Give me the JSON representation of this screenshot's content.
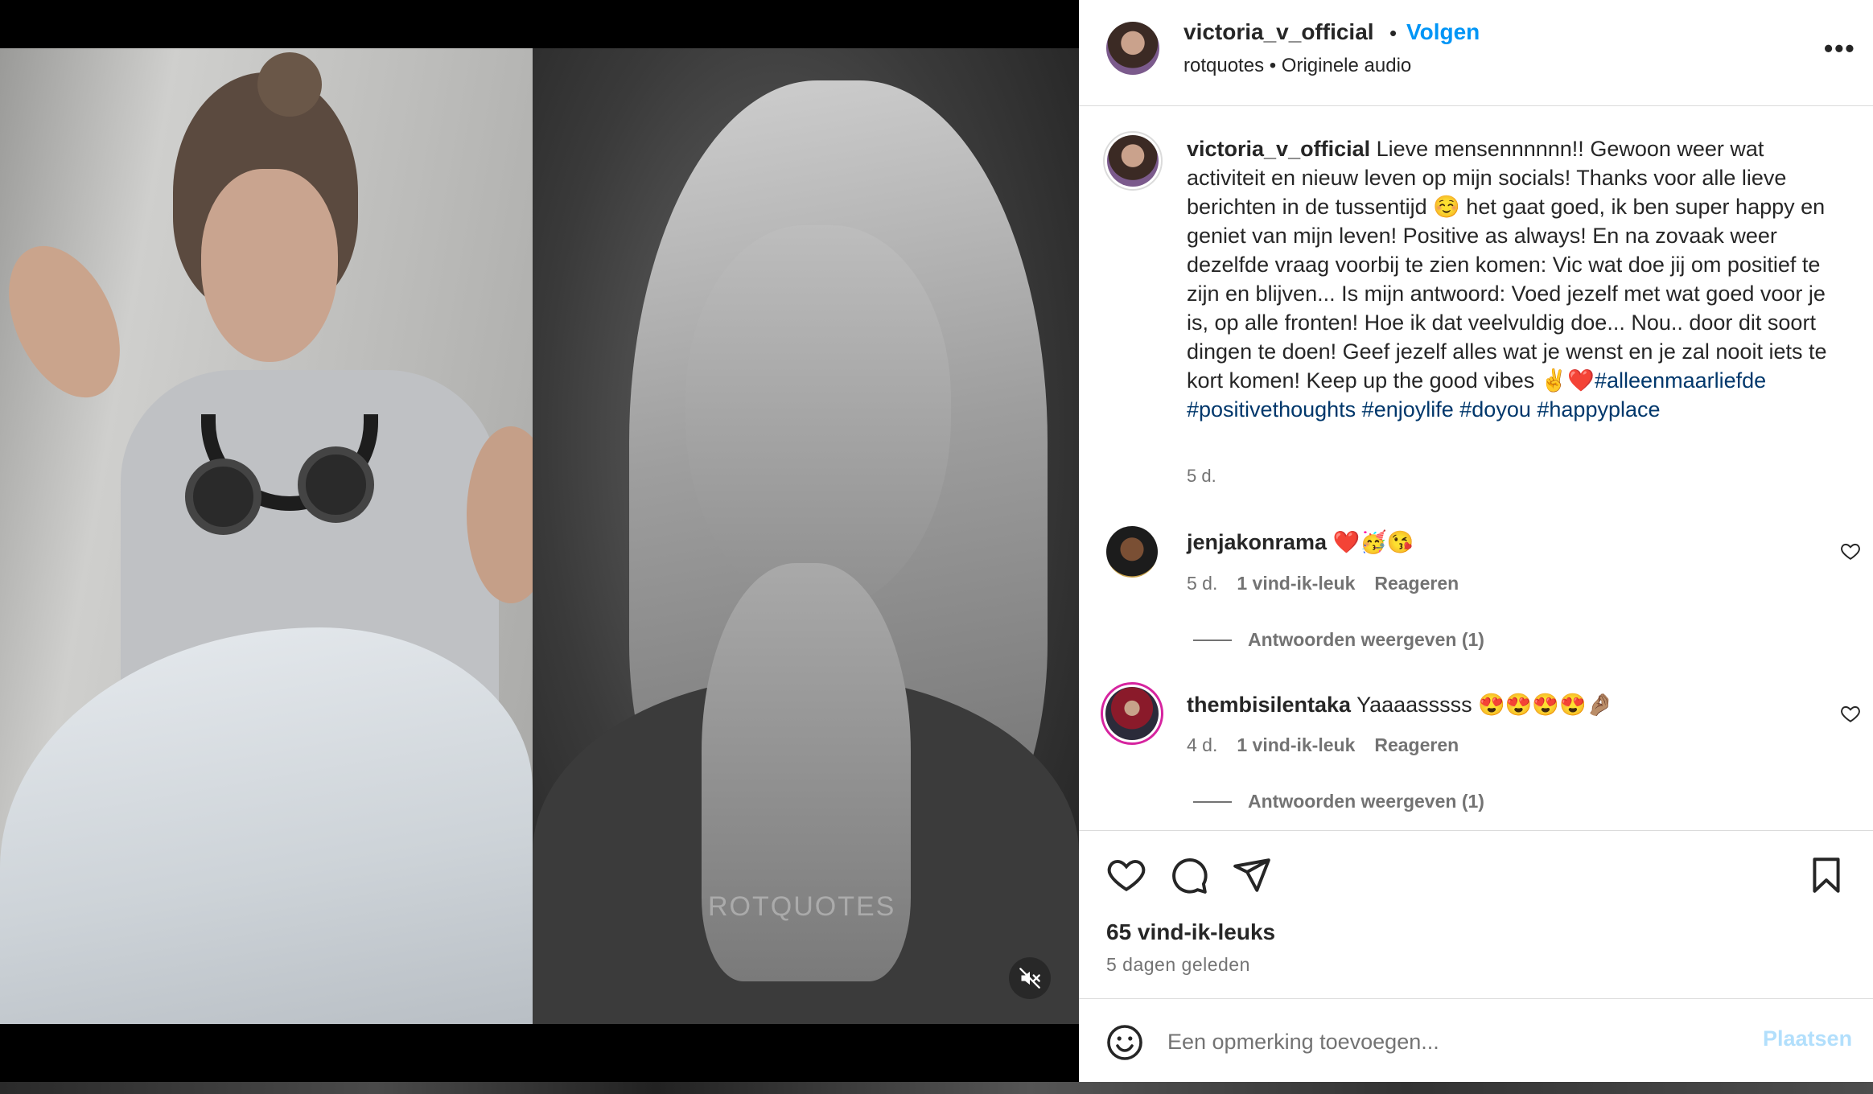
{
  "media": {
    "watermark": "ROTQUOTES",
    "mute_icon": "volume-muted-icon"
  },
  "header": {
    "username": "victoria_v_official",
    "separator": "•",
    "follow_label": "Volgen",
    "subtitle": "rotquotes • Originele audio",
    "more_icon": "more-options-icon",
    "more_label": "•••"
  },
  "caption": {
    "username": "victoria_v_official",
    "text": "Lieve mensennnnnn!! Gewoon weer wat activiteit en nieuw leven op mijn socials! Thanks voor alle lieve berichten in de tussentijd ☺️ het gaat goed, ik ben super happy en geniet van mijn leven! Positive as always! En na zovaak weer dezelfde vraag voorbij te zien komen: Vic wat doe jij om positief te zijn en blijven... Is mijn antwoord: Voed jezelf met wat goed voor je is, op alle fronten! Hoe ik dat veelvuldig doe... Nou.. door dit soort dingen te doen! Geef jezelf alles wat je wenst en je zal nooit iets te kort komen! Keep up the good vibes ✌️❤️",
    "hashtags": [
      "#alleenmaarliefde",
      "#positivethoughts",
      "#enjoylife",
      "#doyou",
      "#happyplace"
    ],
    "time": "5 d."
  },
  "comments": [
    {
      "username": "jenjakonrama",
      "text": "❤️🥳😘",
      "time": "5 d.",
      "likes": "1 vind-ik-leuk",
      "reply_label": "Reageren",
      "view_replies": "Antwoorden weergeven (1)"
    },
    {
      "username": "thembisilentaka",
      "text": "Yaaaasssss 😍😍😍😍🤌🏽",
      "time": "4 d.",
      "likes": "1 vind-ik-leuk",
      "reply_label": "Reageren",
      "view_replies": "Antwoorden weergeven (1)"
    }
  ],
  "actions": {
    "like_icon": "heart-icon",
    "comment_icon": "comment-icon",
    "share_icon": "send-icon",
    "save_icon": "bookmark-icon",
    "likes_count": "65 vind-ik-leuks",
    "posted_ago": "5 dagen geleden"
  },
  "composer": {
    "emoji_icon": "emoji-icon",
    "placeholder": "Een opmerking toevoegen...",
    "post_label": "Plaatsen"
  },
  "colors": {
    "accent": "#0095f6",
    "hashtag": "#00376b",
    "muted": "#737373",
    "post_disabled": "#b2dffc"
  }
}
